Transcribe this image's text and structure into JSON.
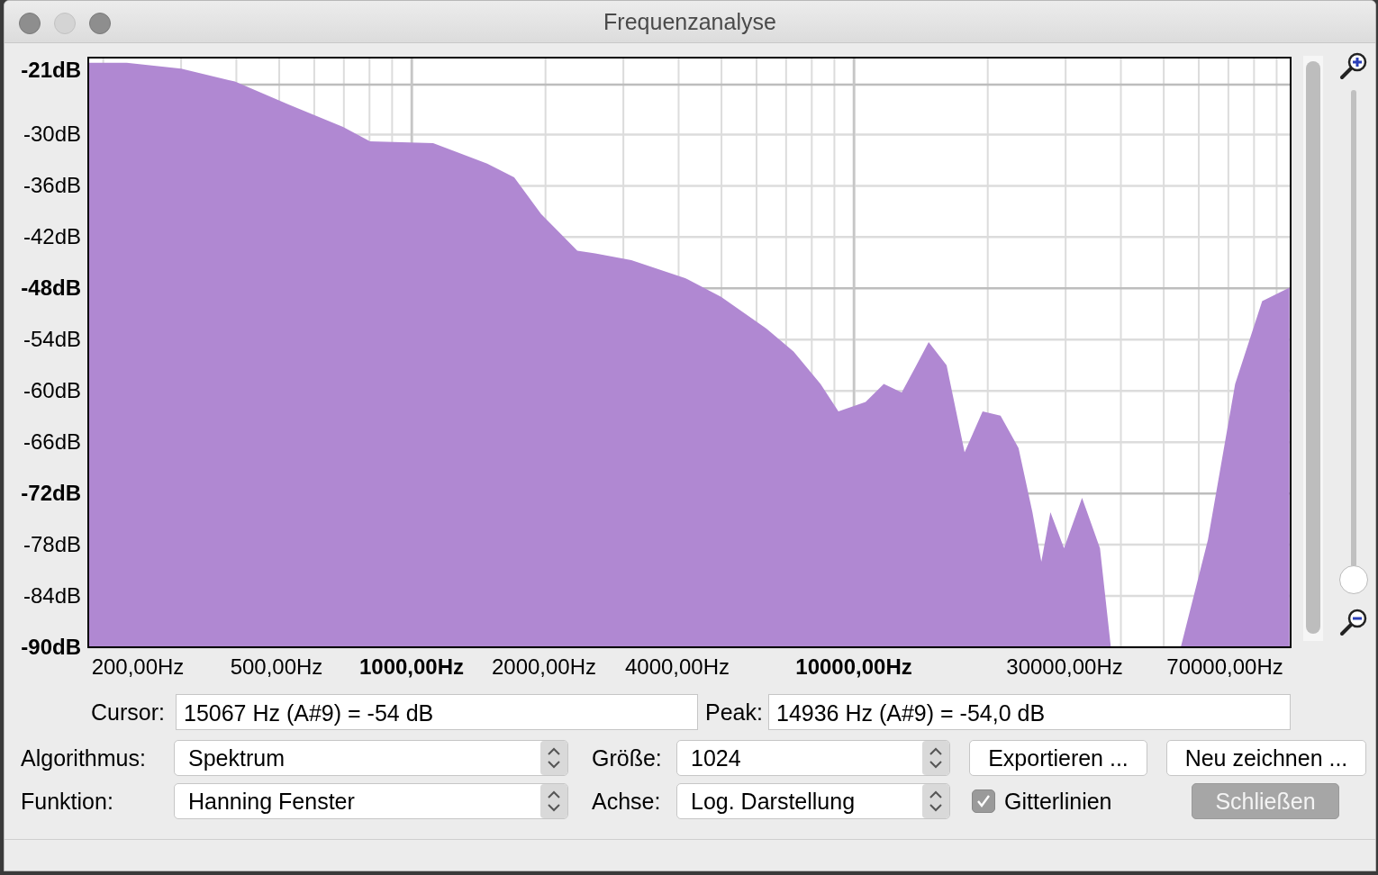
{
  "window": {
    "title": "Frequenzanalyse"
  },
  "spectrum": {
    "y_labels": [
      {
        "text": "-21dB",
        "major": true
      },
      {
        "text": "-30dB",
        "major": false
      },
      {
        "text": "-36dB",
        "major": false
      },
      {
        "text": "-42dB",
        "major": false
      },
      {
        "text": "-48dB",
        "major": true
      },
      {
        "text": "-54dB",
        "major": false
      },
      {
        "text": "-60dB",
        "major": false
      },
      {
        "text": "-66dB",
        "major": false
      },
      {
        "text": "-72dB",
        "major": true
      },
      {
        "text": "-78dB",
        "major": false
      },
      {
        "text": "-84dB",
        "major": false
      },
      {
        "text": "-90dB",
        "major": true
      }
    ],
    "x_labels": [
      {
        "text": "200,00Hz",
        "major": false
      },
      {
        "text": "500,00Hz",
        "major": false
      },
      {
        "text": "1000,00Hz",
        "major": true
      },
      {
        "text": "2000,00Hz",
        "major": false
      },
      {
        "text": "4000,00Hz",
        "major": false
      },
      {
        "text": "10000,00Hz",
        "major": true
      },
      {
        "text": "30000,00Hz",
        "major": false
      },
      {
        "text": "70000,00Hz",
        "major": false
      }
    ]
  },
  "zoom_slider": {
    "level": 0
  },
  "cursor": {
    "label": "Cursor:",
    "value": "15067 Hz (A#9) = -54 dB"
  },
  "peak": {
    "label": "Peak:",
    "value": "14936 Hz (A#9) = -54,0 dB"
  },
  "settings": [
    {
      "label": "Algorithmus:",
      "value": "Spektrum"
    },
    {
      "label": "Größe:",
      "value": "1024"
    },
    {
      "label": "Funktion:",
      "value": "Hanning Fenster"
    },
    {
      "label": "Achse:",
      "value": "Log. Darstellung"
    }
  ],
  "buttons": [
    {
      "label": "Exportieren ...",
      "default": false
    },
    {
      "label": "Neu zeichnen ...",
      "default": false
    },
    {
      "label": "Schließen",
      "default": true
    }
  ],
  "grid_checkbox": {
    "label": "Gitterlinien",
    "checked": true
  }
}
